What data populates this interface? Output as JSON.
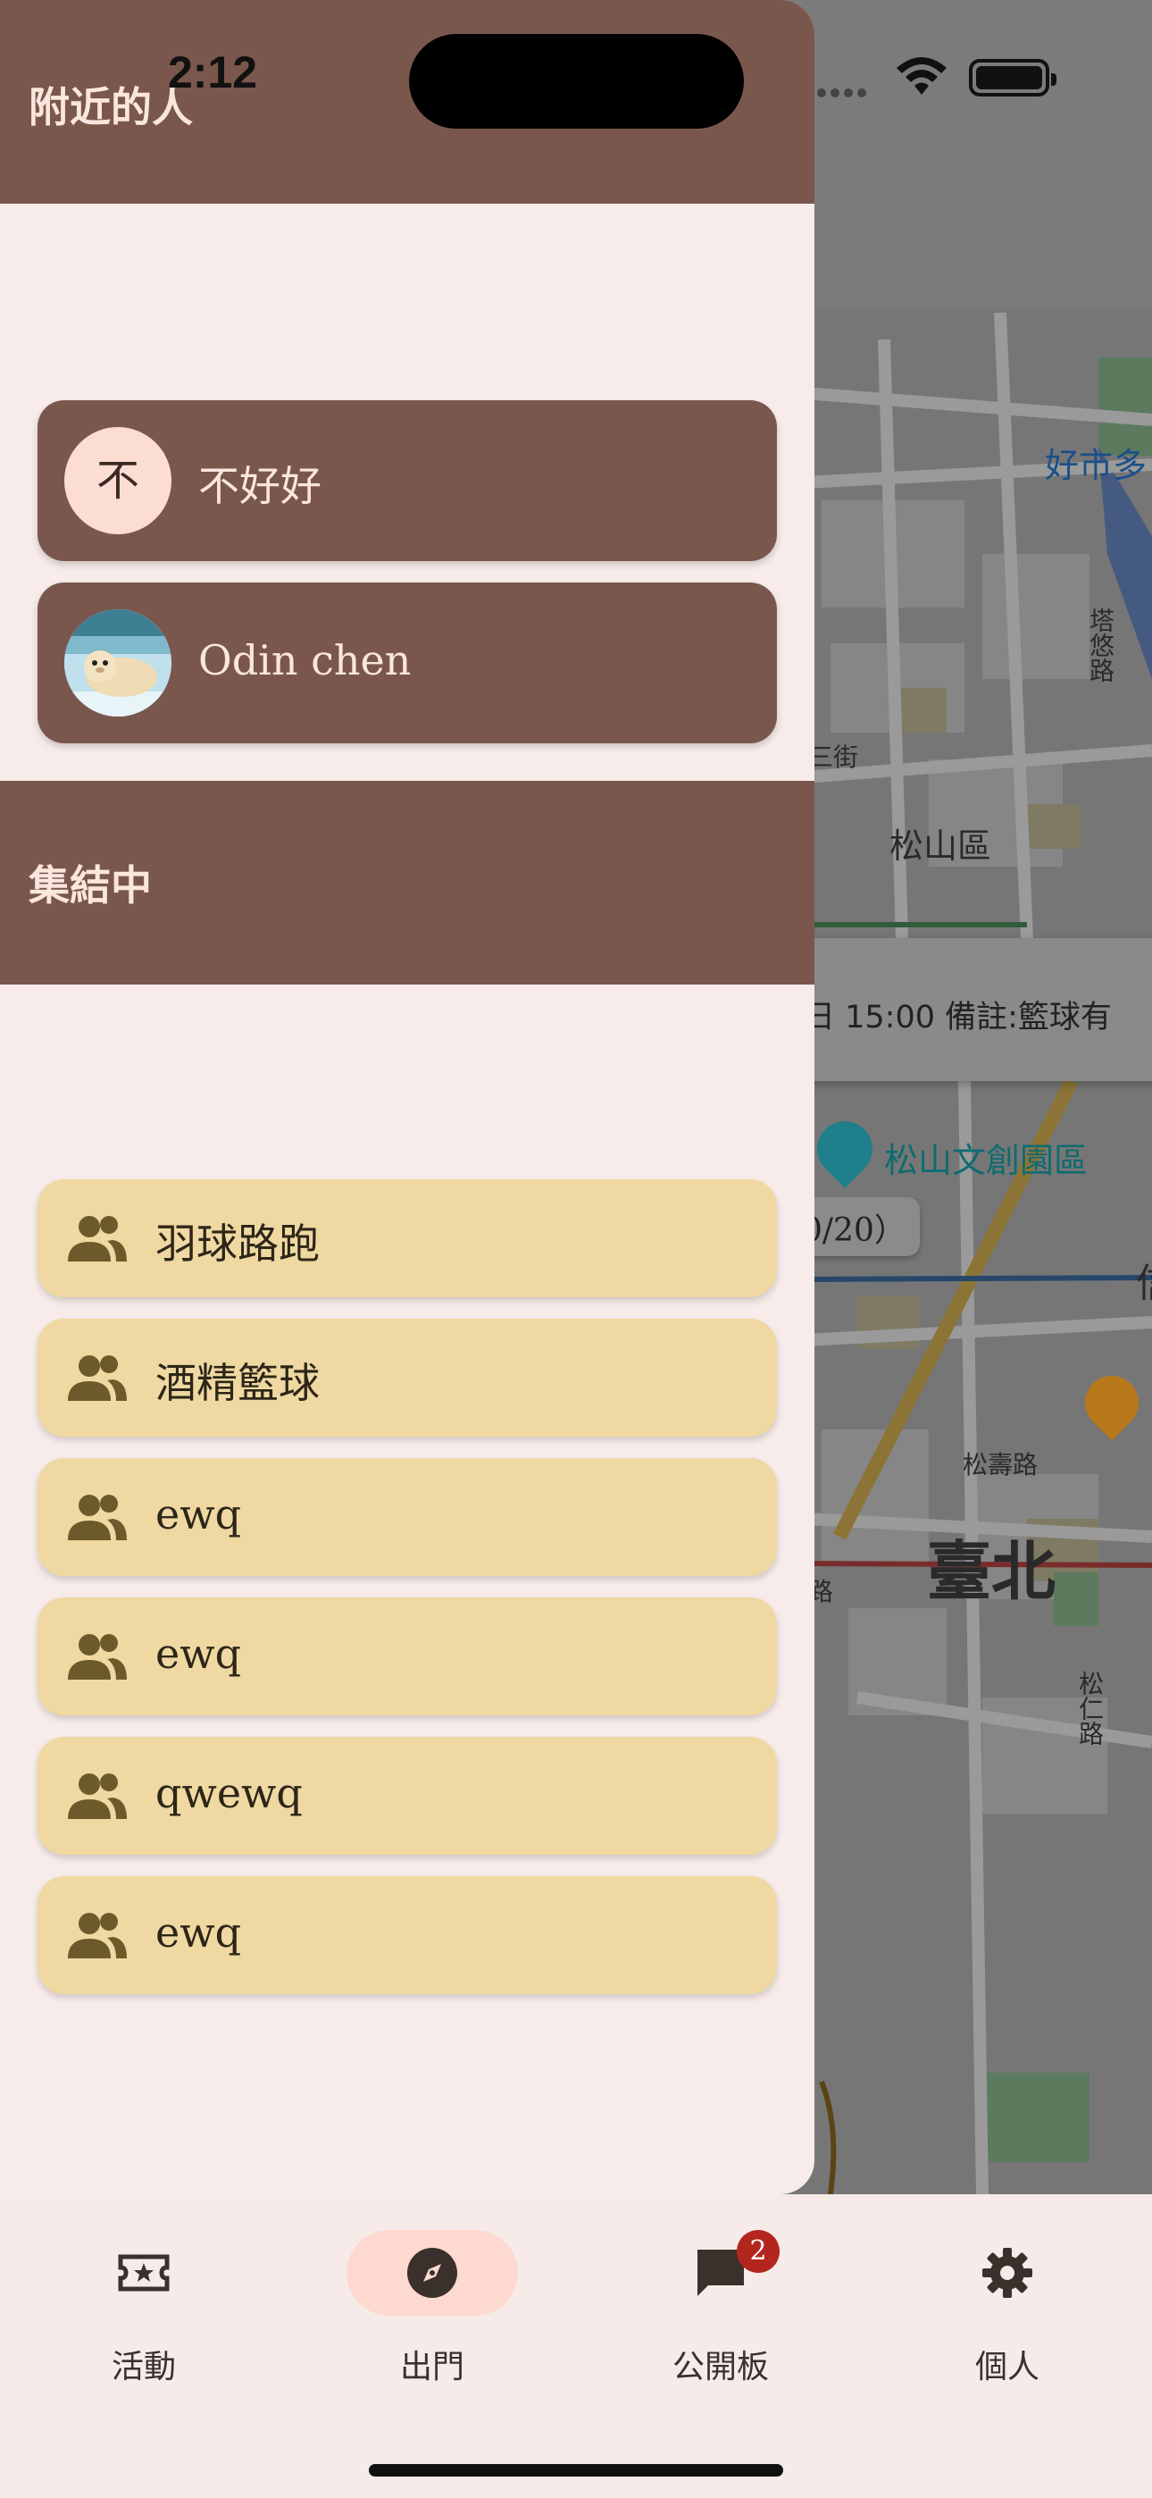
{
  "status_bar": {
    "time": "2:12"
  },
  "map": {
    "labels": {
      "hao_shi_duo": "好市多",
      "ta_you_lu": "塔悠路",
      "san_jie": "三街",
      "songshan_district": "松山區",
      "songshan_park": "松山文創園區",
      "song_shou_rd": "松壽路",
      "taipei": "臺北",
      "song_ren_rd": "松仁路",
      "edge_char": "信",
      "edge_char2": "路"
    },
    "card_text": "日 15:00 備註:籃球有",
    "chip_text": "0/20）"
  },
  "drawer": {
    "nearby": {
      "title": "附近的人",
      "people": [
        {
          "name": "不好好",
          "avatar_letter": "不"
        },
        {
          "name": "Odin chen",
          "avatar_letter": ""
        }
      ]
    },
    "gathering": {
      "title": "集結中",
      "groups": [
        {
          "name": "羽球路跑"
        },
        {
          "name": "酒精籃球"
        },
        {
          "name": "ewq"
        },
        {
          "name": "ewq"
        },
        {
          "name": "qwewq"
        },
        {
          "name": "ewq"
        }
      ]
    }
  },
  "bottom_nav": {
    "items": [
      {
        "label": "活動",
        "icon": "ticket-star-icon"
      },
      {
        "label": "出門",
        "icon": "compass-icon"
      },
      {
        "label": "公開板",
        "icon": "chat-bubble-icon",
        "badge": "2"
      },
      {
        "label": "個人",
        "icon": "gear-icon"
      }
    ]
  },
  "colors": {
    "drawer_header": "#7a574d",
    "person_card": "#7a574d",
    "group_card": "#efd8a2",
    "nav_active": "#fdd9cf",
    "badge": "#b3261e"
  }
}
